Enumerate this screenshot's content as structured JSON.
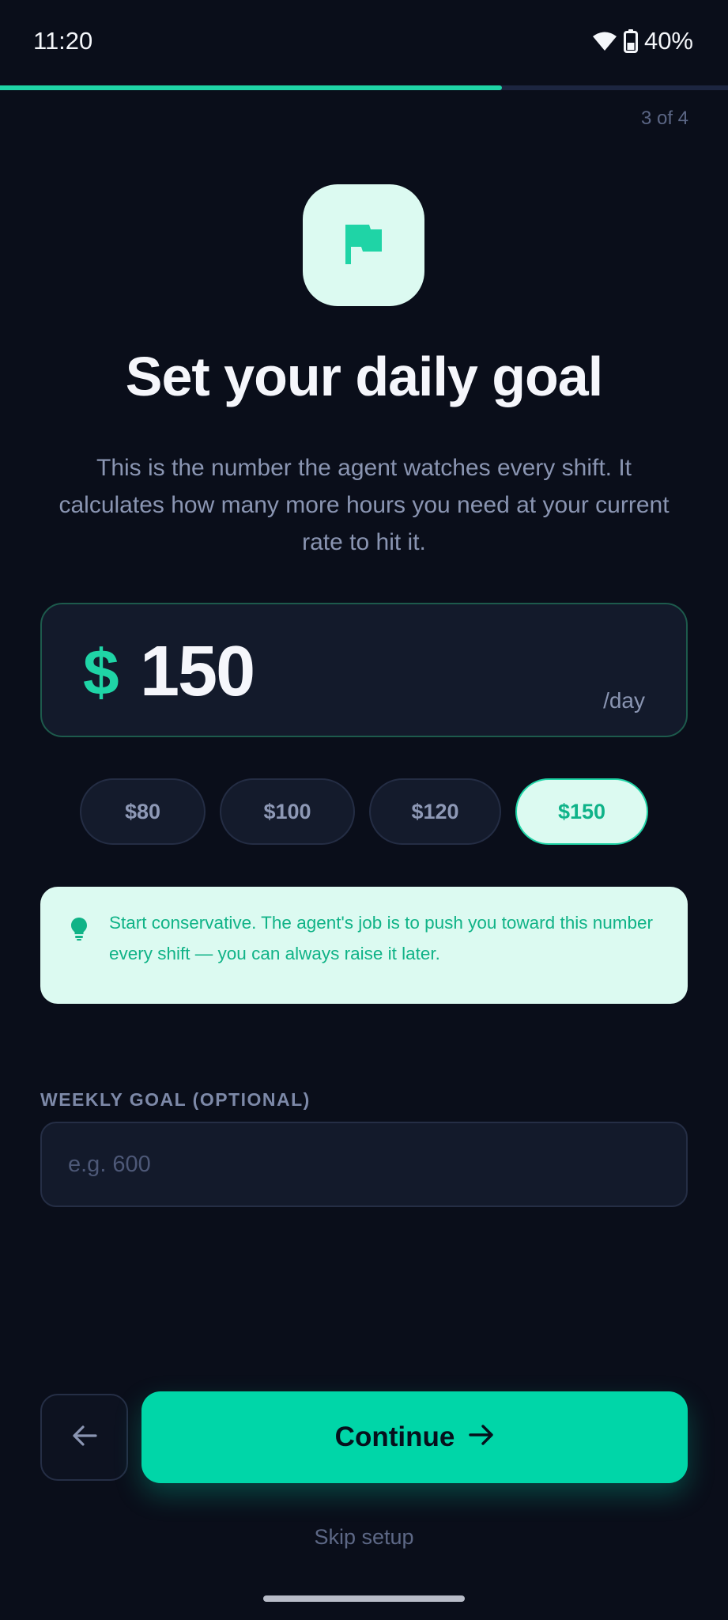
{
  "status_bar": {
    "time": "11:20",
    "battery": "40%",
    "icons": [
      "wifi-icon",
      "battery-icon"
    ]
  },
  "progress": {
    "fraction": 0.75,
    "step_label": "3 of 4"
  },
  "header": {
    "icon": "flag-icon",
    "title": "Set your daily goal",
    "subtitle": "This is the number the agent watches every shift. It calculates how many more hours you need at your current rate to hit it."
  },
  "goal": {
    "currency": "$",
    "value": "150",
    "unit": "/day"
  },
  "presets": [
    {
      "label": "$80",
      "selected": false
    },
    {
      "label": "$100",
      "selected": false
    },
    {
      "label": "$120",
      "selected": false
    },
    {
      "label": "$150",
      "selected": true
    }
  ],
  "tip": {
    "icon": "lightbulb-icon",
    "text": "Start conservative. The agent's job is to push you toward this number every shift — you can always raise it later."
  },
  "weekly": {
    "label": "WEEKLY GOAL (OPTIONAL)",
    "value": "",
    "placeholder": "e.g. 600"
  },
  "actions": {
    "back_icon": "arrow-left-icon",
    "continue_label": "Continue",
    "continue_icon": "arrow-right-icon",
    "skip_label": "Skip setup"
  },
  "colors": {
    "background": "#0a0e1a",
    "accent": "#1fd4a6",
    "accent_light": "#dcfaf1",
    "button": "#00d6a8"
  }
}
